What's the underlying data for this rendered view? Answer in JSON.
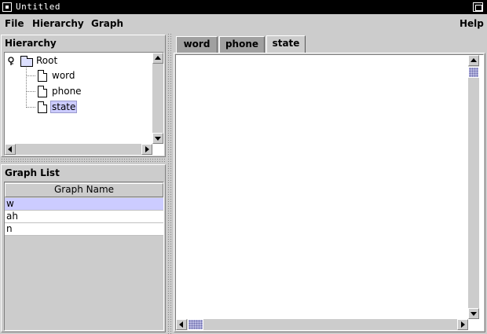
{
  "window": {
    "title": "Untitled"
  },
  "menubar": {
    "items": [
      "File",
      "Hierarchy",
      "Graph"
    ],
    "help": "Help"
  },
  "hierarchy": {
    "title": "Hierarchy",
    "root": "Root",
    "children": [
      "word",
      "phone",
      "state"
    ],
    "selected": "state"
  },
  "graph_list": {
    "title": "Graph List",
    "column": "Graph Name",
    "rows": [
      "w",
      "ah",
      "n"
    ],
    "selected_row": 0
  },
  "tabs": {
    "items": [
      "word",
      "phone",
      "state"
    ],
    "active": 2
  },
  "colors": {
    "selection": "#ccccff",
    "titlebar": "#000000",
    "panel": "#cccccc"
  },
  "icons": [
    "system-menu-icon",
    "maximize-icon",
    "key-icon",
    "folder-icon",
    "document-icon",
    "arrow-up-icon",
    "arrow-down-icon",
    "arrow-left-icon",
    "arrow-right-icon"
  ]
}
